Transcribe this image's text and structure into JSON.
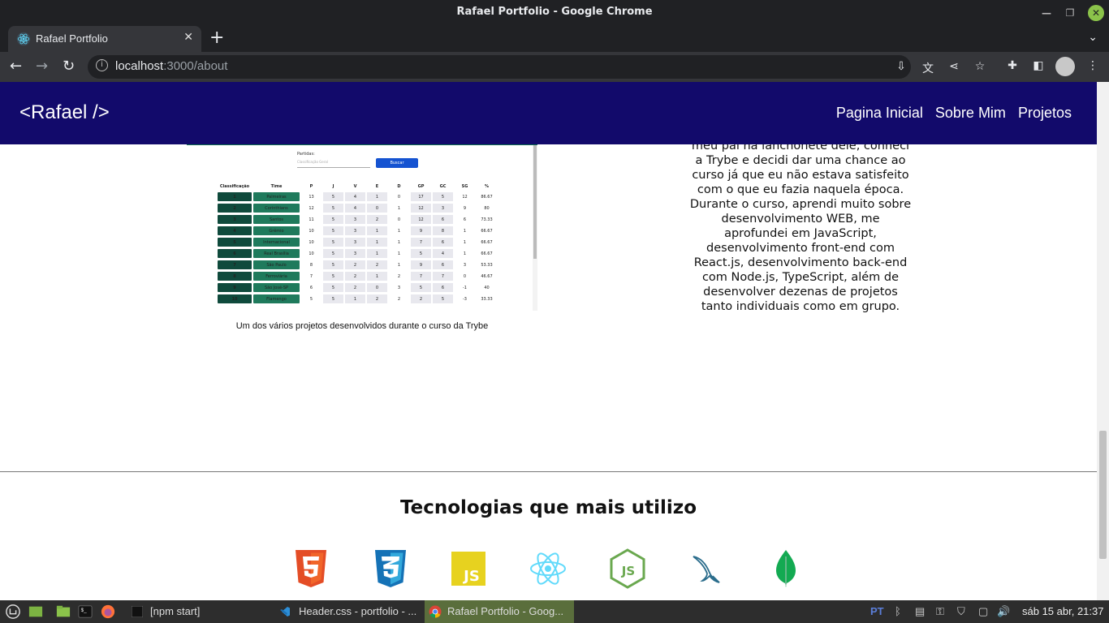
{
  "window": {
    "title": "Rafael Portfolio - Google Chrome"
  },
  "tab": {
    "title": "Rafael Portfolio",
    "close": "✕",
    "new": "+"
  },
  "address": {
    "host": "localhost",
    "rest": ":3000/about"
  },
  "site": {
    "logo": "<Rafael />",
    "nav": [
      "Pagina Inicial",
      "Sobre Mim",
      "Projetos"
    ]
  },
  "project_image": {
    "label": "Partidas:",
    "select_placeholder": "Classificação Geral",
    "button": "Buscar",
    "headers": [
      "Classificação",
      "Time",
      "P",
      "J",
      "V",
      "E",
      "D",
      "GP",
      "GC",
      "SG",
      "%"
    ],
    "rows": [
      [
        "1",
        "Palmeiras",
        "13",
        "5",
        "4",
        "1",
        "0",
        "17",
        "5",
        "12",
        "86.67"
      ],
      [
        "2",
        "Corinthians",
        "12",
        "5",
        "4",
        "0",
        "1",
        "12",
        "3",
        "9",
        "80"
      ],
      [
        "3",
        "Santos",
        "11",
        "5",
        "3",
        "2",
        "0",
        "12",
        "6",
        "6",
        "73.33"
      ],
      [
        "4",
        "Grêmio",
        "10",
        "5",
        "3",
        "1",
        "1",
        "9",
        "8",
        "1",
        "66.67"
      ],
      [
        "5",
        "Internacional",
        "10",
        "5",
        "3",
        "1",
        "1",
        "7",
        "6",
        "1",
        "66.67"
      ],
      [
        "6",
        "Real Brasília",
        "10",
        "5",
        "3",
        "1",
        "1",
        "5",
        "4",
        "1",
        "66.67"
      ],
      [
        "7",
        "São Paulo",
        "8",
        "5",
        "2",
        "2",
        "1",
        "9",
        "6",
        "3",
        "53.33"
      ],
      [
        "8",
        "Ferroviária",
        "7",
        "5",
        "2",
        "1",
        "2",
        "7",
        "7",
        "0",
        "46.67"
      ],
      [
        "9",
        "São José-SP",
        "6",
        "5",
        "2",
        "0",
        "3",
        "5",
        "6",
        "-1",
        "40"
      ],
      [
        "10",
        "Flamengo",
        "5",
        "5",
        "1",
        "2",
        "2",
        "2",
        "5",
        "-3",
        "33.33"
      ]
    ],
    "caption": "Um dos vários projetos desenvolvidos durante o curso da Trybe"
  },
  "about_text": [
    "meu pai na lanchonete dele, conheci",
    "a Trybe e decidi dar uma chance ao",
    "curso já que eu não estava satisfeito",
    "com o que eu fazia naquela época.",
    "Durante o curso, aprendi muito sobre",
    "desenvolvimento WEB, me",
    "aprofundei em JavaScript,",
    "desenvolvimento front-end com",
    "React.js, desenvolvimento back-end",
    "com Node.js, TypeScript, além de",
    "desenvolver dezenas de projetos",
    "tanto individuais como em grupo."
  ],
  "tech": {
    "title": "Tecnologias que mais utilizo",
    "icons": [
      "html5-icon",
      "css3-icon",
      "javascript-icon",
      "react-icon",
      "nodejs-icon",
      "mysql-icon",
      "mongodb-icon"
    ]
  },
  "taskbar": {
    "apps": [
      "[npm start]",
      "Header.css - portfolio - ...",
      "Rafael Portfolio - Goog..."
    ],
    "lang": "PT",
    "clock": "sáb 15 abr, 21:37"
  }
}
